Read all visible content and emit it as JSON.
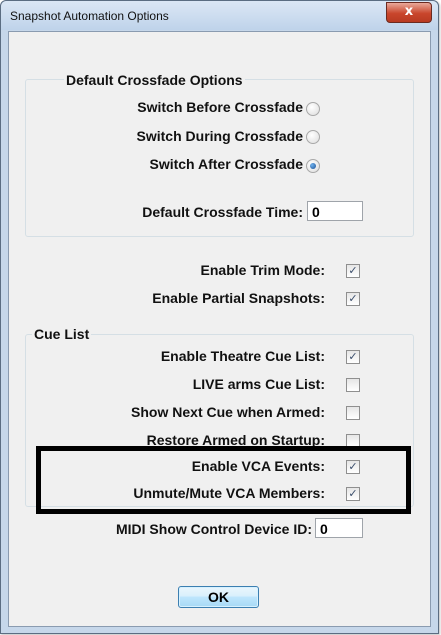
{
  "window": {
    "title": "Snapshot Automation Options",
    "close_glyph": "x"
  },
  "crossfade": {
    "group_title": "Default Crossfade Options",
    "options": [
      {
        "label": "Switch Before Crossfade",
        "selected": false
      },
      {
        "label": "Switch During Crossfade",
        "selected": false
      },
      {
        "label": "Switch After Crossfade",
        "selected": true
      }
    ],
    "time_label": "Default Crossfade Time:",
    "time_value": "0"
  },
  "general": {
    "trim_mode_label": "Enable Trim Mode:",
    "trim_mode_checked": true,
    "partial_label": "Enable Partial Snapshots:",
    "partial_checked": true
  },
  "cue_list": {
    "group_title": "Cue List",
    "items": [
      {
        "label": "Enable Theatre Cue List:",
        "checked": true
      },
      {
        "label": "LIVE arms Cue List:",
        "checked": false
      },
      {
        "label": "Show Next Cue when Armed:",
        "checked": false
      },
      {
        "label": "Restore Armed on Startup:",
        "checked": false
      },
      {
        "label": "Enable VCA Events:",
        "checked": true
      },
      {
        "label": "Unmute/Mute VCA Members:",
        "checked": true
      }
    ]
  },
  "midi": {
    "label": "MIDI Show Control Device ID:",
    "value": "0"
  },
  "buttons": {
    "ok_label": "OK"
  },
  "icons": {
    "check_glyph": "✓",
    "annotation_color": "#000000"
  }
}
